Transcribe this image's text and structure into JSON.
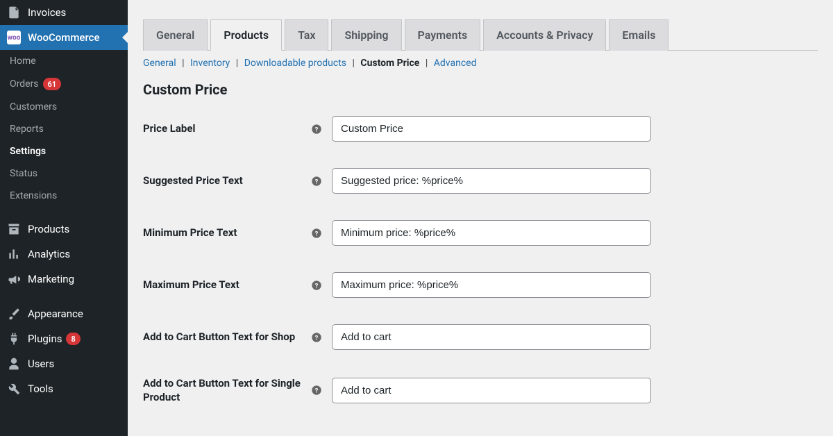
{
  "sidebar": {
    "invoices": "Invoices",
    "woocommerce": "WooCommerce",
    "home": "Home",
    "orders": "Orders",
    "orders_badge": "61",
    "customers": "Customers",
    "reports": "Reports",
    "settings": "Settings",
    "status": "Status",
    "extensions": "Extensions",
    "products": "Products",
    "analytics": "Analytics",
    "marketing": "Marketing",
    "appearance": "Appearance",
    "plugins": "Plugins",
    "plugins_badge": "8",
    "users": "Users",
    "tools": "Tools"
  },
  "tabs": {
    "general": "General",
    "products": "Products",
    "tax": "Tax",
    "shipping": "Shipping",
    "payments": "Payments",
    "accounts_privacy": "Accounts & Privacy",
    "emails": "Emails"
  },
  "subnav": {
    "general": "General",
    "inventory": "Inventory",
    "downloadable": "Downloadable products",
    "custom_price": "Custom Price",
    "advanced": "Advanced"
  },
  "section_title": "Custom Price",
  "fields": {
    "price_label": {
      "label": "Price Label",
      "value": "Custom Price"
    },
    "suggested_price_text": {
      "label": "Suggested Price Text",
      "value": "Suggested price: %price%"
    },
    "minimum_price_text": {
      "label": "Minimum Price Text",
      "value": "Minimum price: %price%"
    },
    "maximum_price_text": {
      "label": "Maximum Price Text",
      "value": "Maximum price: %price%"
    },
    "add_to_cart_shop": {
      "label": "Add to Cart Button Text for Shop",
      "value": "Add to cart"
    },
    "add_to_cart_single": {
      "label": "Add to Cart Button Text for Single Product",
      "value": "Add to cart"
    }
  }
}
